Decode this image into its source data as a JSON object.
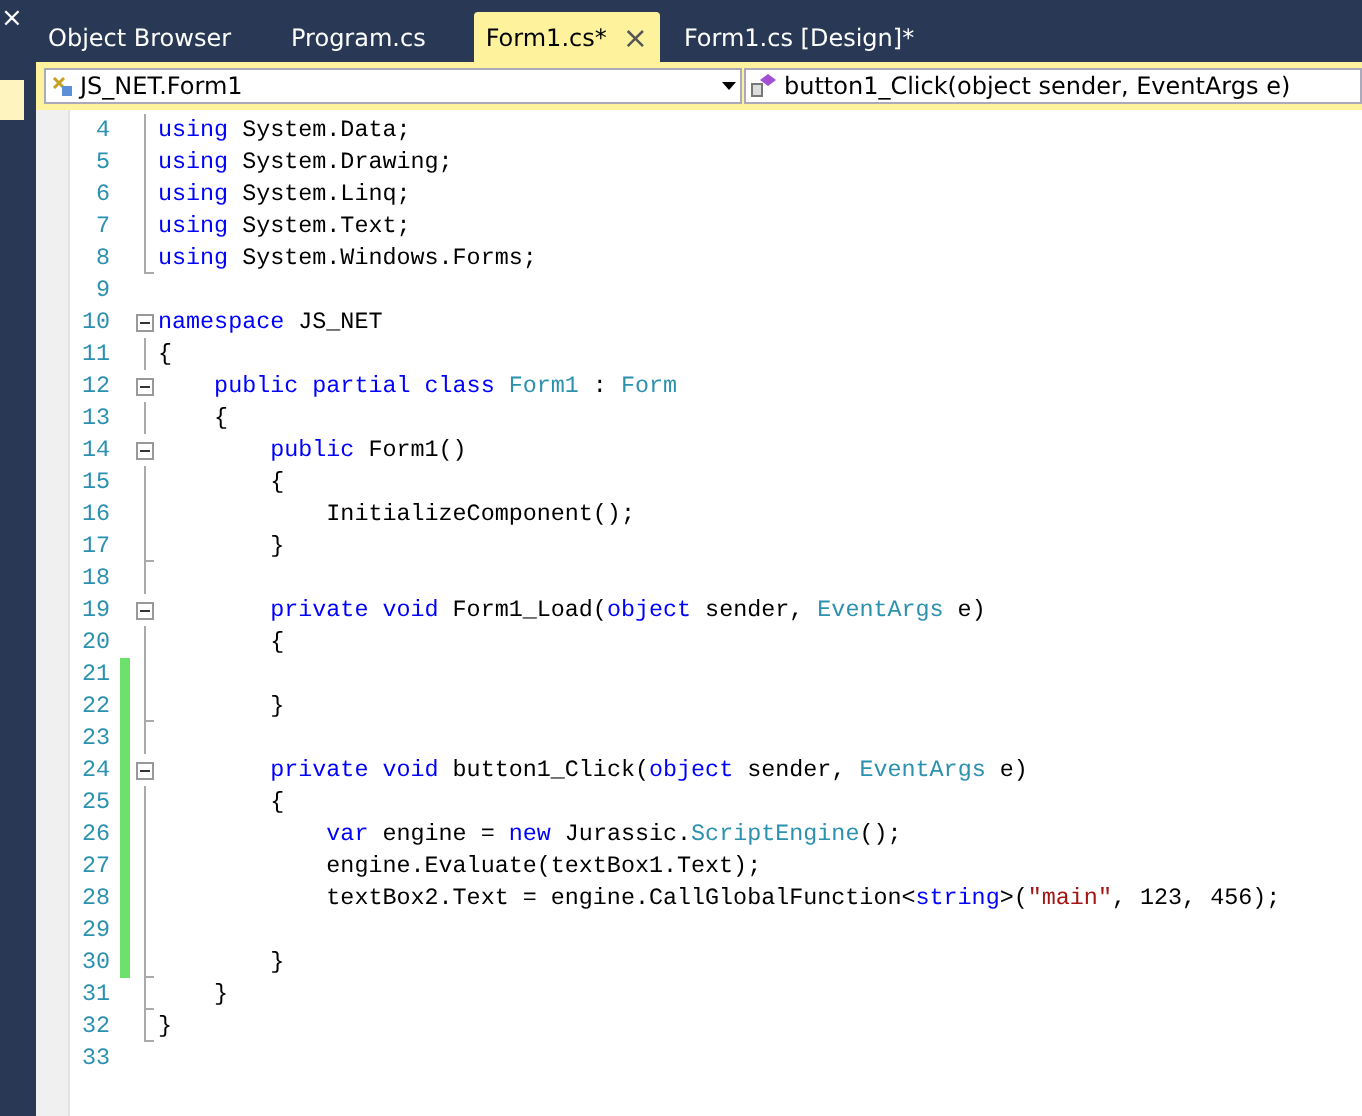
{
  "tabs": [
    {
      "label": "Object Browser",
      "selected": false
    },
    {
      "label": "Program.cs",
      "selected": false
    },
    {
      "label": "Form1.cs*",
      "selected": true,
      "close": "×"
    },
    {
      "label": "Form1.cs [Design]*",
      "selected": false
    }
  ],
  "side_close": "×",
  "navigation": {
    "type_combo": "JS_NET.Form1",
    "member_combo": "button1_Click(object sender, EventArgs e)"
  },
  "lines": [
    {
      "number": "4",
      "collapsible": false,
      "in_block": true,
      "block_end": false,
      "changed": false,
      "tokens": [
        {
          "text": "using",
          "kind": "keyword"
        },
        {
          "text": " System.Data;",
          "kind": "plain"
        }
      ]
    },
    {
      "number": "5",
      "collapsible": false,
      "in_block": true,
      "block_end": false,
      "changed": false,
      "tokens": [
        {
          "text": "using",
          "kind": "keyword"
        },
        {
          "text": " System.Drawing;",
          "kind": "plain"
        }
      ]
    },
    {
      "number": "6",
      "collapsible": false,
      "in_block": true,
      "block_end": false,
      "changed": false,
      "tokens": [
        {
          "text": "using",
          "kind": "keyword"
        },
        {
          "text": " System.Linq;",
          "kind": "plain"
        }
      ]
    },
    {
      "number": "7",
      "collapsible": false,
      "in_block": true,
      "block_end": false,
      "changed": false,
      "tokens": [
        {
          "text": "using",
          "kind": "keyword"
        },
        {
          "text": " System.Text;",
          "kind": "plain"
        }
      ]
    },
    {
      "number": "8",
      "collapsible": false,
      "in_block": true,
      "block_end": true,
      "changed": false,
      "tokens": [
        {
          "text": "using",
          "kind": "keyword"
        },
        {
          "text": " System.Windows.Forms;",
          "kind": "plain"
        }
      ]
    },
    {
      "number": "9",
      "collapsible": false,
      "in_block": false,
      "block_end": false,
      "changed": false
    },
    {
      "number": "10",
      "collapsible": true,
      "in_block": true,
      "block_end": false,
      "changed": false,
      "tokens": [
        {
          "text": "namespace",
          "kind": "keyword"
        },
        {
          "text": " JS_NET",
          "kind": "plain"
        }
      ]
    },
    {
      "number": "11",
      "collapsible": false,
      "in_block": true,
      "block_end": false,
      "changed": false,
      "tokens": [
        {
          "text": "{",
          "kind": "plain"
        }
      ]
    },
    {
      "number": "12",
      "collapsible": true,
      "in_block": true,
      "block_end": false,
      "changed": false,
      "tokens": [
        {
          "text": "    public partial class",
          "kind": "keyword"
        },
        {
          "text": " Form1",
          "kind": "type"
        },
        {
          "text": " : ",
          "kind": "plain"
        },
        {
          "text": "Form",
          "kind": "type"
        }
      ]
    },
    {
      "number": "13",
      "collapsible": false,
      "in_block": true,
      "block_end": false,
      "changed": false,
      "tokens": [
        {
          "text": "    {",
          "kind": "plain"
        }
      ]
    },
    {
      "number": "14",
      "collapsible": true,
      "in_block": true,
      "block_end": false,
      "changed": false,
      "tokens": [
        {
          "text": "        public",
          "kind": "keyword"
        },
        {
          "text": " Form1()",
          "kind": "plain"
        }
      ]
    },
    {
      "number": "15",
      "collapsible": false,
      "in_block": true,
      "block_end": false,
      "changed": false,
      "tokens": [
        {
          "text": "        {",
          "kind": "plain"
        }
      ]
    },
    {
      "number": "16",
      "collapsible": false,
      "in_block": true,
      "block_end": false,
      "changed": false,
      "tokens": [
        {
          "text": "            InitializeComponent();",
          "kind": "plain"
        }
      ]
    },
    {
      "number": "17",
      "collapsible": false,
      "in_block": true,
      "block_end": true,
      "changed": false,
      "tokens": [
        {
          "text": "        }",
          "kind": "plain"
        }
      ]
    },
    {
      "number": "18",
      "collapsible": false,
      "in_block": true,
      "block_end": false,
      "changed": false
    },
    {
      "number": "19",
      "collapsible": true,
      "in_block": true,
      "block_end": false,
      "changed": false,
      "tokens": [
        {
          "text": "        private void",
          "kind": "keyword"
        },
        {
          "text": " Form1_Load(",
          "kind": "plain"
        },
        {
          "text": "object",
          "kind": "keyword"
        },
        {
          "text": " sender, ",
          "kind": "plain"
        },
        {
          "text": "EventArgs",
          "kind": "type"
        },
        {
          "text": " e)",
          "kind": "plain"
        }
      ]
    },
    {
      "number": "20",
      "collapsible": false,
      "in_block": true,
      "block_end": false,
      "changed": false,
      "tokens": [
        {
          "text": "        {",
          "kind": "plain"
        }
      ]
    },
    {
      "number": "21",
      "collapsible": false,
      "in_block": true,
      "block_end": false,
      "changed": true
    },
    {
      "number": "22",
      "collapsible": false,
      "in_block": true,
      "block_end": true,
      "changed": true,
      "tokens": [
        {
          "text": "        }",
          "kind": "plain"
        }
      ]
    },
    {
      "number": "23",
      "collapsible": false,
      "in_block": true,
      "block_end": false,
      "changed": true
    },
    {
      "number": "24",
      "collapsible": true,
      "in_block": true,
      "block_end": false,
      "changed": true,
      "tokens": [
        {
          "text": "        private void",
          "kind": "keyword"
        },
        {
          "text": " button1_Click(",
          "kind": "plain"
        },
        {
          "text": "object",
          "kind": "keyword"
        },
        {
          "text": " sender, ",
          "kind": "plain"
        },
        {
          "text": "EventArgs",
          "kind": "type"
        },
        {
          "text": " e)",
          "kind": "plain"
        }
      ]
    },
    {
      "number": "25",
      "collapsible": false,
      "in_block": true,
      "block_end": false,
      "changed": true,
      "tokens": [
        {
          "text": "        {",
          "kind": "plain"
        }
      ]
    },
    {
      "number": "26",
      "collapsible": false,
      "in_block": true,
      "block_end": false,
      "changed": true,
      "tokens": [
        {
          "text": "            var",
          "kind": "keyword"
        },
        {
          "text": " engine = ",
          "kind": "plain"
        },
        {
          "text": "new",
          "kind": "keyword"
        },
        {
          "text": " Jurassic.",
          "kind": "plain"
        },
        {
          "text": "ScriptEngine",
          "kind": "type"
        },
        {
          "text": "();",
          "kind": "plain"
        }
      ]
    },
    {
      "number": "27",
      "collapsible": false,
      "in_block": true,
      "block_end": false,
      "changed": true,
      "tokens": [
        {
          "text": "            engine.Evaluate(textBox1.Text);",
          "kind": "plain"
        }
      ]
    },
    {
      "number": "28",
      "collapsible": false,
      "in_block": true,
      "block_end": false,
      "changed": true,
      "tokens": [
        {
          "text": "            textBox2.Text = engine.CallGlobalFunction<",
          "kind": "plain"
        },
        {
          "text": "string",
          "kind": "keyword"
        },
        {
          "text": ">(",
          "kind": "plain"
        },
        {
          "text": "\"main\"",
          "kind": "string"
        },
        {
          "text": ", 123, 456);",
          "kind": "plain"
        }
      ]
    },
    {
      "number": "29",
      "collapsible": false,
      "in_block": true,
      "block_end": false,
      "changed": true
    },
    {
      "number": "30",
      "collapsible": false,
      "in_block": true,
      "block_end": true,
      "changed": true,
      "tokens": [
        {
          "text": "        }",
          "kind": "plain"
        }
      ]
    },
    {
      "number": "31",
      "collapsible": false,
      "in_block": true,
      "block_end": true,
      "changed": false,
      "tokens": [
        {
          "text": "    }",
          "kind": "plain"
        }
      ]
    },
    {
      "number": "32",
      "collapsible": false,
      "in_block": true,
      "block_end": true,
      "changed": false,
      "tokens": [
        {
          "text": "}",
          "kind": "plain"
        }
      ]
    },
    {
      "number": "33",
      "collapsible": false,
      "in_block": false,
      "block_end": false,
      "changed": false
    }
  ]
}
